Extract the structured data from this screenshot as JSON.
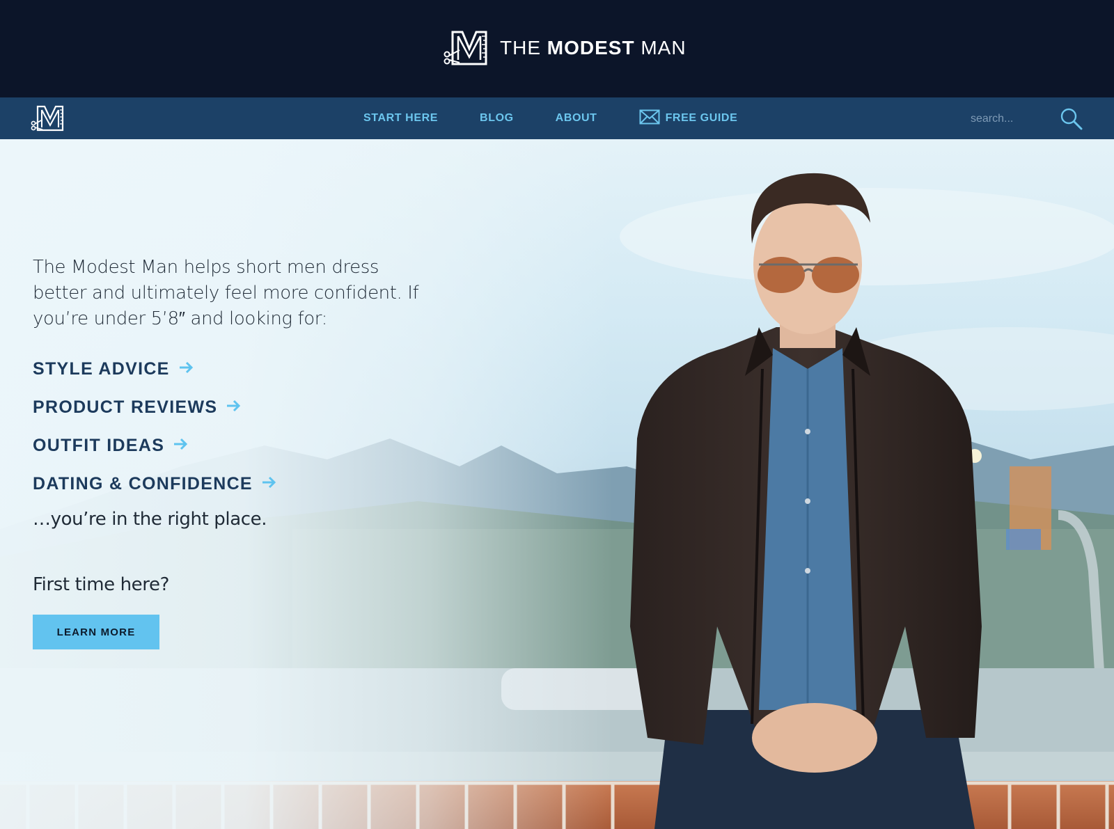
{
  "header": {
    "brand_light_1": "THE ",
    "brand_bold": "MODEST",
    "brand_light_2": " MAN"
  },
  "nav": {
    "links": [
      {
        "label": "START HERE"
      },
      {
        "label": "BLOG"
      },
      {
        "label": "ABOUT"
      },
      {
        "label": "FREE GUIDE",
        "icon": "envelope-icon"
      }
    ],
    "search_placeholder": "search...",
    "search_icon": "search-icon"
  },
  "hero": {
    "intro": "The Modest Man helps short men dress better and ultimately feel more confident. If you’re under 5’8″ and looking for:",
    "topics": [
      {
        "label": "STYLE ADVICE",
        "icon": "arrow-right-icon"
      },
      {
        "label": "PRODUCT REVIEWS",
        "icon": "arrow-right-icon"
      },
      {
        "label": "OUTFIT IDEAS",
        "icon": "arrow-right-icon"
      },
      {
        "label": "DATING & CONFIDENCE",
        "icon": "arrow-right-icon"
      }
    ],
    "closing": "…you’re in the right place.",
    "first_time": "First time here?",
    "cta_label": "LEARN MORE"
  },
  "colors": {
    "header_bg": "#0c1529",
    "nav_bg": "#1c4167",
    "nav_link": "#6cc6ee",
    "topic_text": "#1c3a5c",
    "accent_arrow": "#5ec3ef",
    "cta_bg": "#62c3ef"
  }
}
